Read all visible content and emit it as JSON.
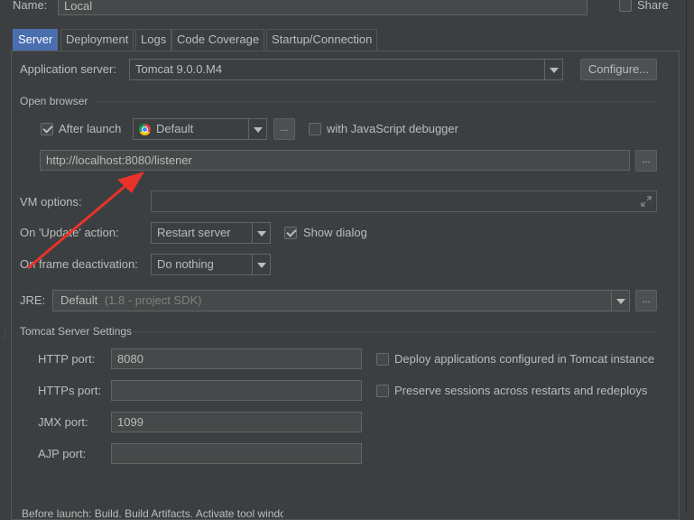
{
  "top": {
    "name_label": "Name:",
    "name_value": "Local",
    "share_label": "Share"
  },
  "tabs": [
    {
      "label": "Server"
    },
    {
      "label": "Deployment"
    },
    {
      "label": "Logs"
    },
    {
      "label": "Code Coverage"
    },
    {
      "label": "Startup/Connection"
    }
  ],
  "server": {
    "app_server_label": "Application server:",
    "app_server_value": "Tomcat 9.0.0.M4",
    "configure_label": "Configure...",
    "open_browser_label": "Open browser",
    "after_launch_label": "After launch",
    "after_launch_checked": true,
    "browser_value": "Default",
    "ellipsis": "...",
    "js_debugger_label": "with JavaScript debugger",
    "url_value": "http://localhost:8080/listener",
    "vm_options_label": "VM options:",
    "vm_options_value": "",
    "update_action_label": "On 'Update' action:",
    "update_action_value": "Restart server",
    "show_dialog_label": "Show dialog",
    "frame_deactivation_label": "On frame deactivation:",
    "frame_deactivation_value": "Do nothing",
    "jre_label": "JRE:",
    "jre_value": "Default",
    "jre_hint": "(1.8 - project SDK)",
    "tomcat_settings_label": "Tomcat Server Settings",
    "http_port_label": "HTTP port:",
    "http_port_value": "8080",
    "https_port_label": "HTTPs port:",
    "https_port_value": "",
    "jmx_port_label": "JMX port:",
    "jmx_port_value": "1099",
    "ajp_port_label": "AJP port:",
    "ajp_port_value": "",
    "deploy_apps_label": "Deploy applications configured in Tomcat instance",
    "preserve_sessions_label": "Preserve sessions across restarts and redeploys"
  },
  "bottom": {
    "before_launch_text": "Before launch: Build, Build Artifacts, Activate tool window"
  },
  "colors": {
    "background": "#3c3f41",
    "selected_tab": "#4b6eaf",
    "annotation_arrow": "#e8322c"
  }
}
